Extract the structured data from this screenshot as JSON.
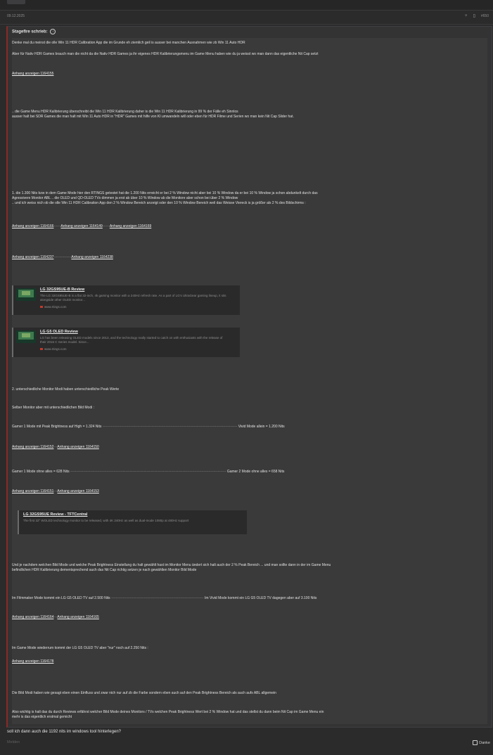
{
  "post": {
    "date": "09.12.2025",
    "post_number": "#650",
    "share_icon": "share-icon",
    "bookmark_icon": "bookmark-icon"
  },
  "quote": {
    "author_label": "Stagefire schrieb:",
    "paragraphs": {
      "p1": "Denke mal du meinst die olle Win 11 HDR Calibration App die im Grunde eh ziemlich geil is ausser bei manchen Ausnahmen wie zb Win 11 Auto HDR",
      "p2": "Aber für Nativ HDR Games brauch man die nicht da die Nativ HDR Games ja ihr eigenes HDR Kalibrierungsmenu im Game Menu haben wie du ja weisst wo man dann das eigentliche Nit Cap setzt",
      "p3a": ".. die Game Menu HDR Kalibrierung überschreibt die Win 11 HDR Kalibrierung daher is die Win 11 HDR Kalibrierung in 99 % der Fälle eh Sinnlos",
      "p3b": "ausser halt bei SDR Games die man halt mit Win 11 Auto HDR in \"HDR\" Games mit hilfe von KI umwandeln will oder eben für HDR Filme und Serien wo man kein Nit Cap Slider hat.",
      "p4a": "1. die 1.300 Nits bzw in dem Game Mode hier den RTINGS getestet hat die 1.200 Nits erreicht er bei 2 % Window nicht aber bei 10 % Window da er bei 10 % Window ja schon abdunkelt durch das",
      "p4b": "Agressivere Monitor ABL .. die OLED und QD-OLED TVs dimmen ja erst ab über 10 % Window ab die Monitore aber schon bei über 2 % Window",
      "p4c": ".. und ich weiss nich ob die olle Win 11 HDR Calibration App den 2 % Window Bereich anzeigt oder den 10 % Window Bereich weil das Weisse Viereck is ja größer als 2 % des Bildschirms :",
      "p5": "2. unterschiedliche Monitor Modi haben unterschiedliche Peak Werte",
      "p6": "Selber Monitor aber mit unterschiedlichen Bild Modi :",
      "p7a": "Gamer 1 Mode mit Peak Brightness auf High = 1.324 Nits",
      "p7b": "Vivid Mode allein = 1.200 Nits",
      "p8a": "Gamer 1 Mode ohne alles = 628 Nits",
      "p8b": "Gamer 2 Mode ohne alles = 658 Nits",
      "p9a": "Und je nachdem welchen Bild Mode und welche Peak Brightness Einstellung du halt gewählt hast im Monitor Menu ändert sich halt auch der 2 % Peak Bereich ... und man sollte dann in der im Game Menu",
      "p9b": "befindlichen HDR Kalibrierung dementsprechend auch das Nit Cap richtig setzen je nach gewählten Monitor Bild Mode",
      "p10a": "Im Filmmaker Mode kommt ein LG G5 OLED TV auf 2.500 Nits",
      "p10b": "Im Vivid Mode kommt ein LG G5 OLED TV dagegen aber auf 3.100 Nits",
      "p11": "Im Game Mode wiederrum kommt der LG G5 OLED TV aber \"nur\" noch auf 2.250 Nits :",
      "p12": "Die Bild Modi haben wie gesagt eben einen Einfluss und zwar nich nur auf zb die Farbe sondern eben auch auf den Peak Brightness Bereich als auch aufs ABL allgemein",
      "p13a": "Also wichtig is halt das du durch Reviews erfährst welcher Bild Mode deines Monitors / TVs welchen Peak Brightness Wert bei 2 % Window hat und das stellst du dann beim Nit Cap im Game Menu ein",
      "p13b": "mehr is das eigentlich erstmal gemicht"
    },
    "dashes": {
      "short": "------",
      "medium": "---------------",
      "long7": "-------------------------------------------------------------------------------------------------------------------",
      "long8": "-------------------------------------------------------------------------------------------------------------------------------------",
      "long10": "-------------------------------------------------------------------------------",
      "tiny": "---"
    },
    "attachments": {
      "a155": "Anhang anzeigen 1164155",
      "a166": "Anhang anzeigen 1164166",
      "a149": "Anhang anzeigen 1164149",
      "a169": "Anhang anzeigen 1164169",
      "a237": "Anhang anzeigen 1164237",
      "a238": "Anhang anzeigen 1164238",
      "a152": "Anhang anzeigen 1164152",
      "a150": "Anhang anzeigen 1164150",
      "a151": "Anhang anzeigen 1164151",
      "a153": "Anhang anzeigen 1164153",
      "a164": "Anhang anzeigen 1164164",
      "a165": "Anhang anzeigen 1164165",
      "a178": "Anhang anzeigen 1164178"
    },
    "cards": [
      {
        "title": "LG 32GS95UE-B Review",
        "desc": "The LG 32GS95UE-B is a flat 32-inch, 4k gaming monitor with a 240Hz refresh rate. As a part of LG's UltraGear gaming lineup, it sits alongside other OLED monitor...",
        "source": "www.rtings.com"
      },
      {
        "title": "LG G5 OLED Review",
        "desc": "LG has been releasing OLED models since 2013, and the technology really started to catch on with enthusiasts with the release of their 2016 C Series model. Since...",
        "source": "www.rtings.com"
      },
      {
        "title": "LG 32GS95UE Review - TFTCentral",
        "desc": "The first 32\" WOLED technology monitor to be released, with 4K 240Hz as well as dual-mode 1080p at 480Hz support",
        "source": "tftcentral.co.uk"
      }
    ]
  },
  "reply_text": "soll ich dann auch die 1192 nits im windows tool hinterlegen?",
  "footer": {
    "report": "Melden",
    "like": "Danke"
  }
}
